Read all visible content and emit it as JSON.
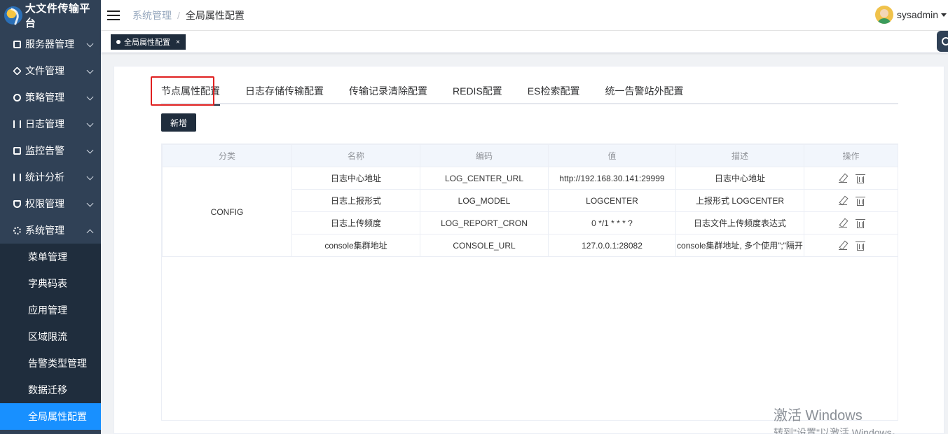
{
  "app": {
    "title": "大文件传输平台"
  },
  "sidebar": {
    "items": [
      {
        "label": "服务器管理",
        "icon": "cube-icon",
        "expanded": false
      },
      {
        "label": "文件管理",
        "icon": "layers-icon",
        "expanded": false
      },
      {
        "label": "策略管理",
        "icon": "target-icon",
        "expanded": false
      },
      {
        "label": "日志管理",
        "icon": "log-icon",
        "expanded": false
      },
      {
        "label": "监控告警",
        "icon": "monitor-icon",
        "expanded": false
      },
      {
        "label": "统计分析",
        "icon": "stats-icon",
        "expanded": false
      },
      {
        "label": "权限管理",
        "icon": "shield-icon",
        "expanded": false
      },
      {
        "label": "系统管理",
        "icon": "gear-icon",
        "expanded": true
      }
    ],
    "sub_items": [
      {
        "label": "菜单管理",
        "active": false
      },
      {
        "label": "字典码表",
        "active": false
      },
      {
        "label": "应用管理",
        "active": false
      },
      {
        "label": "区域限流",
        "active": false
      },
      {
        "label": "告警类型管理",
        "active": false
      },
      {
        "label": "数据迁移",
        "active": false
      },
      {
        "label": "全局属性配置",
        "active": true
      }
    ]
  },
  "header": {
    "breadcrumb": [
      "系统管理",
      "全局属性配置"
    ],
    "separator": "/",
    "username": "sysadmin"
  },
  "tags": {
    "active_label": "全局属性配置",
    "close": "×"
  },
  "main": {
    "tabs": [
      "节点属性配置",
      "日志存储传输配置",
      "传输记录清除配置",
      "REDIS配置",
      "ES检索配置",
      "统一告警站外配置"
    ],
    "add_button": "新增",
    "table": {
      "headers": [
        "分类",
        "名称",
        "编码",
        "值",
        "描述",
        "操作"
      ],
      "category": "CONFIG",
      "rows": [
        {
          "name": "日志中心地址",
          "code": "LOG_CENTER_URL",
          "value": "http://192.168.30.141:29999",
          "desc": "日志中心地址"
        },
        {
          "name": "日志上报形式",
          "code": "LOG_MODEL",
          "value": "LOGCENTER",
          "desc": "上报形式 LOGCENTER"
        },
        {
          "name": "日志上传频度",
          "code": "LOG_REPORT_CRON",
          "value": "0 */1 * * * ?",
          "desc": "日志文件上传频度表达式"
        },
        {
          "name": "console集群地址",
          "code": "CONSOLE_URL",
          "value": "127.0.0.1:28082",
          "desc": "console集群地址, 多个使用\";\"隔开"
        }
      ]
    }
  },
  "watermark": {
    "line1": "激活 Windows",
    "line2": "转到\"设置\"以激活 Windows。"
  },
  "colors": {
    "sidebar_bg": "#304156",
    "submenu_bg": "#1f2d3d",
    "active_blue": "#1890ff",
    "highlight_red": "#e02020"
  }
}
